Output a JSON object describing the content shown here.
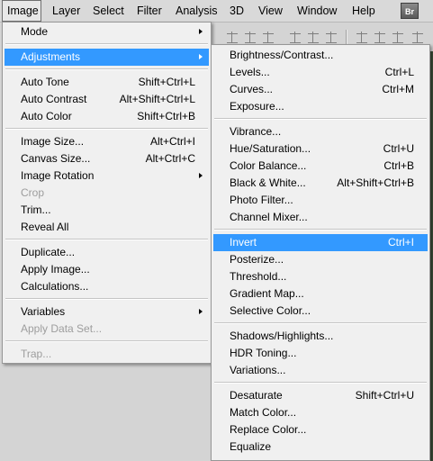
{
  "menubar": {
    "items": [
      "Image",
      "Layer",
      "Select",
      "Filter",
      "Analysis",
      "3D",
      "View",
      "Window",
      "Help"
    ],
    "br_label": "Br"
  },
  "image_menu": [
    {
      "label": "Mode",
      "submenu": true
    },
    {
      "sep": true
    },
    {
      "label": "Adjustments",
      "submenu": true,
      "highlighted": true
    },
    {
      "sep": true
    },
    {
      "label": "Auto Tone",
      "shortcut": "Shift+Ctrl+L"
    },
    {
      "label": "Auto Contrast",
      "shortcut": "Alt+Shift+Ctrl+L"
    },
    {
      "label": "Auto Color",
      "shortcut": "Shift+Ctrl+B"
    },
    {
      "sep": true
    },
    {
      "label": "Image Size...",
      "shortcut": "Alt+Ctrl+I"
    },
    {
      "label": "Canvas Size...",
      "shortcut": "Alt+Ctrl+C"
    },
    {
      "label": "Image Rotation",
      "submenu": true
    },
    {
      "label": "Crop",
      "disabled": true
    },
    {
      "label": "Trim..."
    },
    {
      "label": "Reveal All"
    },
    {
      "sep": true
    },
    {
      "label": "Duplicate..."
    },
    {
      "label": "Apply Image..."
    },
    {
      "label": "Calculations..."
    },
    {
      "sep": true
    },
    {
      "label": "Variables",
      "submenu": true
    },
    {
      "label": "Apply Data Set...",
      "disabled": true
    },
    {
      "sep": true
    },
    {
      "label": "Trap...",
      "disabled": true
    }
  ],
  "adjustments_menu": [
    {
      "label": "Brightness/Contrast..."
    },
    {
      "label": "Levels...",
      "shortcut": "Ctrl+L"
    },
    {
      "label": "Curves...",
      "shortcut": "Ctrl+M"
    },
    {
      "label": "Exposure..."
    },
    {
      "sep": true
    },
    {
      "label": "Vibrance..."
    },
    {
      "label": "Hue/Saturation...",
      "shortcut": "Ctrl+U"
    },
    {
      "label": "Color Balance...",
      "shortcut": "Ctrl+B"
    },
    {
      "label": "Black & White...",
      "shortcut": "Alt+Shift+Ctrl+B"
    },
    {
      "label": "Photo Filter..."
    },
    {
      "label": "Channel Mixer..."
    },
    {
      "sep": true
    },
    {
      "label": "Invert",
      "shortcut": "Ctrl+I",
      "highlighted": true
    },
    {
      "label": "Posterize..."
    },
    {
      "label": "Threshold..."
    },
    {
      "label": "Gradient Map..."
    },
    {
      "label": "Selective Color..."
    },
    {
      "sep": true
    },
    {
      "label": "Shadows/Highlights..."
    },
    {
      "label": "HDR Toning..."
    },
    {
      "label": "Variations..."
    },
    {
      "sep": true
    },
    {
      "label": "Desaturate",
      "shortcut": "Shift+Ctrl+U"
    },
    {
      "label": "Match Color..."
    },
    {
      "label": "Replace Color..."
    },
    {
      "label": "Equalize"
    }
  ],
  "colors": {
    "highlight": "#3399ff",
    "disabled": "#9d9d9d",
    "menu_bg": "#f0f0f0"
  }
}
